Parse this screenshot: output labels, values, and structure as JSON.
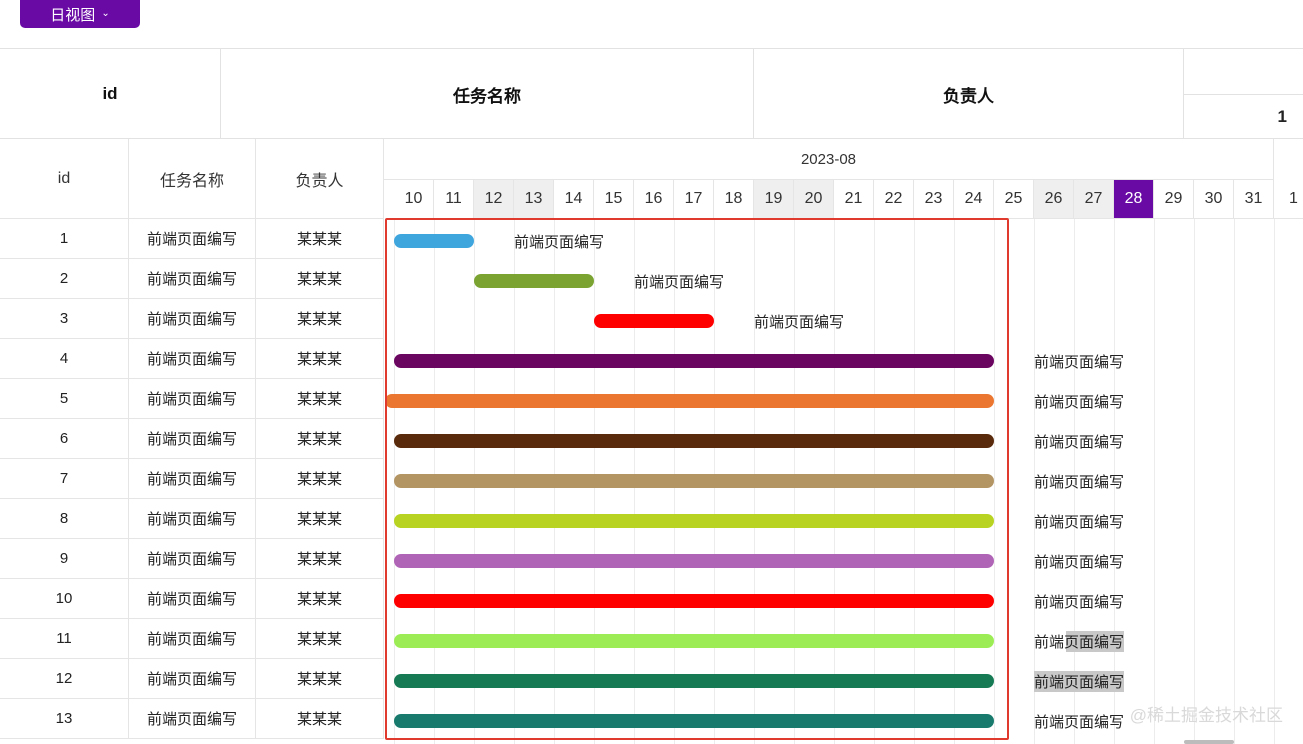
{
  "toolbar": {
    "view_label": "日视图",
    "chevron": "chevron-down-icon"
  },
  "top_table": {
    "col_id": "id",
    "col_task": "任务名称",
    "col_owner": "负责人",
    "extra_value": "1"
  },
  "gantt": {
    "col_id": "id",
    "col_task": "任务名称",
    "col_owner": "负责人",
    "month": "2023-08",
    "days": [
      "10",
      "11",
      "12",
      "13",
      "14",
      "15",
      "16",
      "17",
      "18",
      "19",
      "20",
      "21",
      "22",
      "23",
      "24",
      "25",
      "26",
      "27",
      "28",
      "29",
      "30",
      "31",
      "1"
    ],
    "weekend_days": [
      "12",
      "13",
      "19",
      "20",
      "26",
      "27"
    ],
    "today": "28",
    "rows": [
      {
        "id": "1",
        "task": "前端页面编写",
        "owner": "某某某",
        "bar_label": "前端页面编写",
        "color": "#3fa5dd",
        "start": "10",
        "end": "11"
      },
      {
        "id": "2",
        "task": "前端页面编写",
        "owner": "某某某",
        "bar_label": "前端页面编写",
        "color": "#7ba332",
        "start": "12",
        "end": "14"
      },
      {
        "id": "3",
        "task": "前端页面编写",
        "owner": "某某某",
        "bar_label": "前端页面编写",
        "color": "#ff0000",
        "start": "15",
        "end": "17"
      },
      {
        "id": "4",
        "task": "前端页面编写",
        "owner": "某某某",
        "bar_label": "前端页面编写",
        "color": "#6a0560",
        "start": "10",
        "end": "24"
      },
      {
        "id": "5",
        "task": "前端页面编写",
        "owner": "某某某",
        "bar_label": "前端页面编写",
        "color": "#ea7630",
        "start": "10",
        "end": "24"
      },
      {
        "id": "6",
        "task": "前端页面编写",
        "owner": "某某某",
        "bar_label": "前端页面编写",
        "color": "#5a2a0c",
        "start": "10",
        "end": "24"
      },
      {
        "id": "7",
        "task": "前端页面编写",
        "owner": "某某某",
        "bar_label": "前端页面编写",
        "color": "#b39463",
        "start": "10",
        "end": "24"
      },
      {
        "id": "8",
        "task": "前端页面编写",
        "owner": "某某某",
        "bar_label": "前端页面编写",
        "color": "#b8d322",
        "start": "10",
        "end": "24"
      },
      {
        "id": "9",
        "task": "前端页面编写",
        "owner": "某某某",
        "bar_label": "前端页面编写",
        "color": "#b064b5",
        "start": "10",
        "end": "24"
      },
      {
        "id": "10",
        "task": "前端页面编写",
        "owner": "某某某",
        "bar_label": "前端页面编写",
        "color": "#ff0000",
        "start": "10",
        "end": "24"
      },
      {
        "id": "11",
        "task": "前端页面编写",
        "owner": "某某某",
        "bar_label": "前端页面编写",
        "color": "#9ced55",
        "start": "10",
        "end": "24"
      },
      {
        "id": "12",
        "task": "前端页面编写",
        "owner": "某某某",
        "bar_label": "前端页面编写",
        "color": "#167a55",
        "start": "10",
        "end": "24"
      },
      {
        "id": "13",
        "task": "前端页面编写",
        "owner": "某某某",
        "bar_label": "前端页面编写",
        "color": "#187a6c",
        "start": "10",
        "end": "24"
      }
    ]
  },
  "watermark": "@稀土掘金技术社区"
}
